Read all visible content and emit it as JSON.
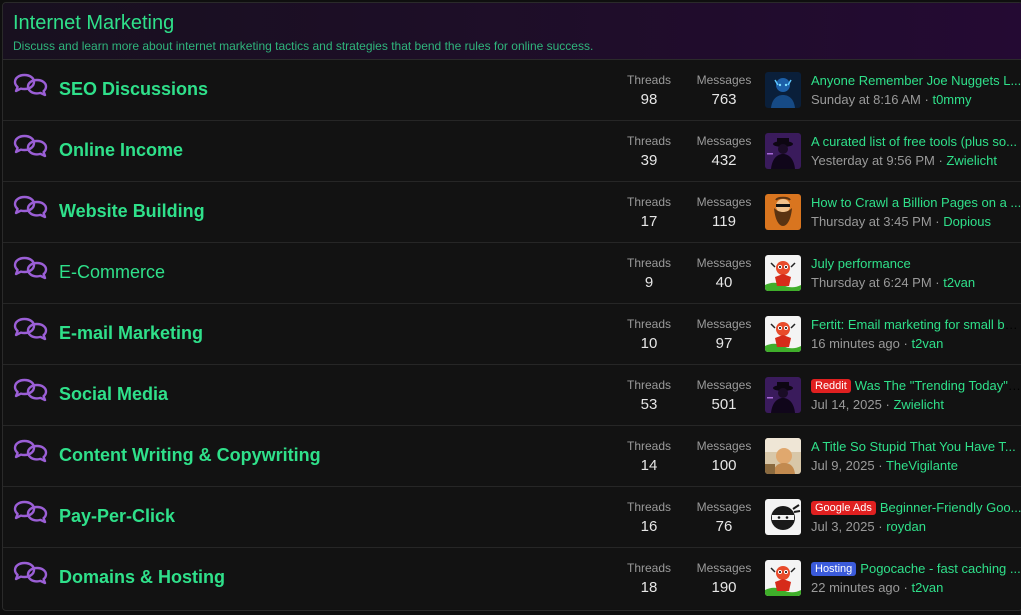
{
  "category": {
    "title": "Internet Marketing",
    "description": "Discuss and learn more about internet marketing tactics and strategies that bend the rules for online success."
  },
  "labels": {
    "threads": "Threads",
    "messages": "Messages",
    "separator": "·"
  },
  "colors": {
    "accent": "#2fe08a",
    "icon": "#9b5fd6",
    "muted": "#9a9a9a"
  },
  "forums": [
    {
      "title": "SEO Discussions",
      "threads": "98",
      "messages": "763",
      "avatar": "blue-hacker-avatar",
      "prefix": "",
      "prefix_color": "",
      "latest_title": "Anyone Remember Joe Nuggets L...",
      "latest_date": "Sunday at 8:16 AM",
      "latest_user": "t0mmy"
    },
    {
      "title": "Online Income",
      "threads": "39",
      "messages": "432",
      "avatar": "purple-spy-avatar",
      "prefix": "",
      "prefix_color": "",
      "latest_title": "A curated list of free tools (plus so...",
      "latest_date": "Yesterday at 9:56 PM",
      "latest_user": "Zwielicht"
    },
    {
      "title": "Website Building",
      "threads": "17",
      "messages": "119",
      "avatar": "bearded-man-avatar",
      "prefix": "",
      "prefix_color": "",
      "latest_title": "How to Crawl a Billion Pages on a ...",
      "latest_date": "Thursday at 3:45 PM",
      "latest_user": "Dopious"
    },
    {
      "title": "E-Commerce",
      "threads": "9",
      "messages": "40",
      "avatar": "cartoon-avatar",
      "prefix": "",
      "prefix_color": "",
      "latest_title": "July performance",
      "latest_date": "Thursday at 6:24 PM",
      "latest_user": "t2van"
    },
    {
      "title": "E-mail Marketing",
      "threads": "10",
      "messages": "97",
      "avatar": "cartoon-avatar",
      "prefix": "",
      "prefix_color": "",
      "latest_title": "Fertit: Email marketing for small bu...",
      "latest_date": "16 minutes ago",
      "latest_user": "t2van"
    },
    {
      "title": "Social Media",
      "threads": "53",
      "messages": "501",
      "avatar": "purple-spy-avatar",
      "prefix": "Reddit",
      "prefix_color": "#e02020",
      "latest_title": "Was The \"Trending Today\" ...",
      "latest_date": "Jul 14, 2025",
      "latest_user": "Zwielicht"
    },
    {
      "title": "Content Writing & Copywriting",
      "threads": "14",
      "messages": "100",
      "avatar": "photo-avatar",
      "prefix": "",
      "prefix_color": "",
      "latest_title": "A Title So Stupid That You Have T...",
      "latest_date": "Jul 9, 2025",
      "latest_user": "TheVigilante"
    },
    {
      "title": "Pay-Per-Click",
      "threads": "16",
      "messages": "76",
      "avatar": "ninja-avatar",
      "prefix": "Google Ads",
      "prefix_color": "#e02020",
      "latest_title": "Beginner-Friendly Goo...",
      "latest_date": "Jul 3, 2025",
      "latest_user": "roydan"
    },
    {
      "title": "Domains & Hosting",
      "threads": "18",
      "messages": "190",
      "avatar": "cartoon-avatar",
      "prefix": "Hosting",
      "prefix_color": "#3b5bdb",
      "latest_title": "Pogocache - fast caching ...",
      "latest_date": "22 minutes ago",
      "latest_user": "t2van"
    }
  ]
}
